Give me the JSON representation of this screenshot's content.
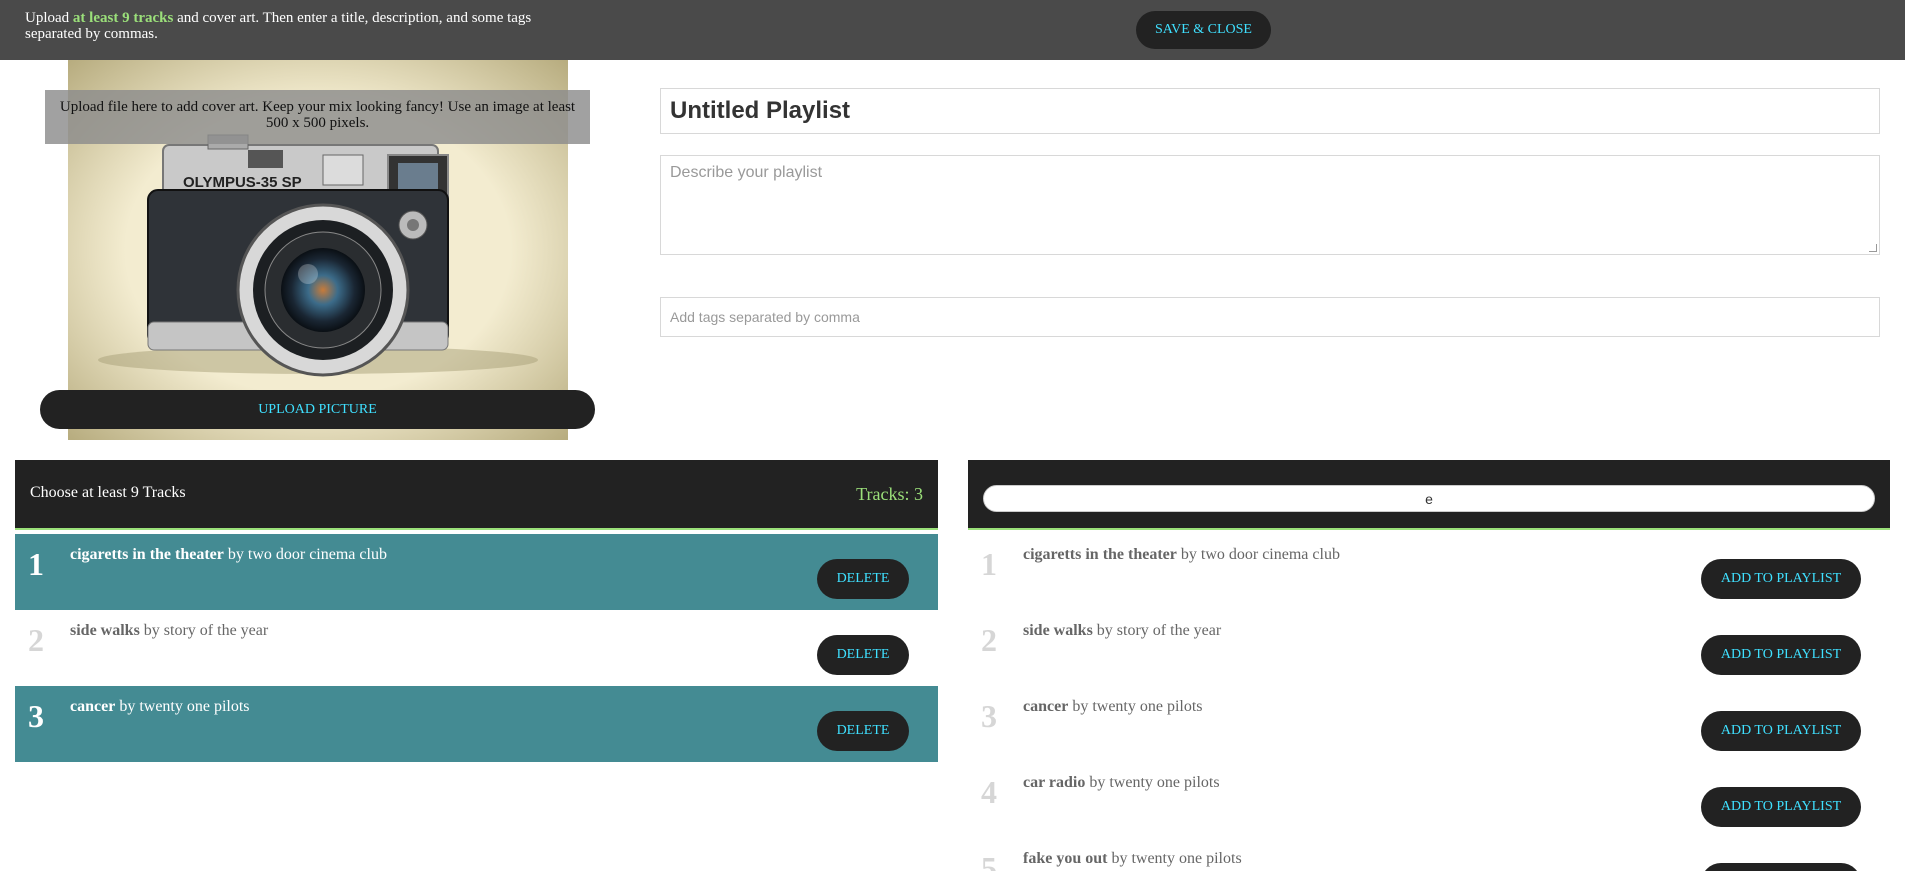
{
  "topbar": {
    "instr_pre": "Upload ",
    "instr_hl": "at least 9 tracks",
    "instr_post": " and cover art. Then enter a title, description, and some tags separated by commas.",
    "save_label": "SAVE & CLOSE"
  },
  "cover": {
    "notice": "Upload file here to add cover art. Keep your mix looking fancy! Use an image at least 500 x 500 pixels.",
    "upload_label": "UPLOAD PICTURE",
    "camera_brand": "OLYMPUS-35 SP"
  },
  "form": {
    "title_value": "Untitled Playlist",
    "description_placeholder": "Describe your playlist",
    "tags_placeholder": "Add tags separated by comma"
  },
  "playlist": {
    "heading": "Choose at least 9 Tracks",
    "count_label": "Tracks: 3",
    "delete_label": "DELETE",
    "by": "by",
    "tracks": [
      {
        "num": "1",
        "title": "cigaretts in the theater",
        "artist": "two door cinema club"
      },
      {
        "num": "2",
        "title": "side walks",
        "artist": "story of the year"
      },
      {
        "num": "3",
        "title": "cancer",
        "artist": "twenty one pilots"
      }
    ]
  },
  "search": {
    "query": "e",
    "add_label": "ADD TO PLAYLIST",
    "results": [
      {
        "num": "1",
        "title": "cigaretts in the theater",
        "artist": "two door cinema club"
      },
      {
        "num": "2",
        "title": "side walks",
        "artist": "story of the year"
      },
      {
        "num": "3",
        "title": "cancer",
        "artist": "twenty one pilots"
      },
      {
        "num": "4",
        "title": "car radio",
        "artist": "twenty one pilots"
      },
      {
        "num": "5",
        "title": "fake you out",
        "artist": "twenty one pilots"
      }
    ]
  },
  "colors": {
    "accent_cyan": "#3fe0ff",
    "accent_green": "#9be07a",
    "selected_row": "#448b93",
    "dark": "#222222"
  }
}
